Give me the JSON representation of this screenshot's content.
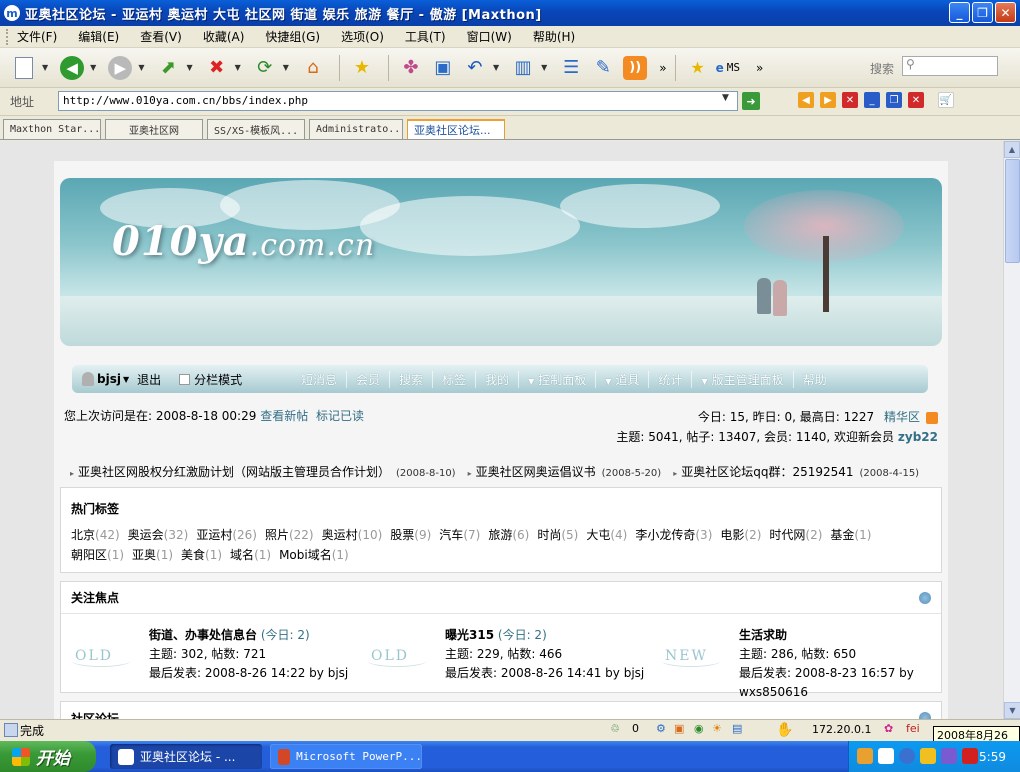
{
  "window": {
    "title": "亚奥社区论坛 - 亚运村 奥运村 大屯 社区网 街道 娱乐 旅游 餐厅 - 傲游 [Maxthon]"
  },
  "menu": [
    "文件(F)",
    "编辑(E)",
    "查看(V)",
    "收藏(A)",
    "快捷组(G)",
    "选项(O)",
    "工具(T)",
    "窗口(W)",
    "帮助(H)"
  ],
  "toolbar": {
    "ms_label": "MS",
    "search_label": "搜索"
  },
  "address": {
    "label": "地址",
    "url": "http://www.010ya.com.cn/bbs/index.php"
  },
  "tabs": [
    "Maxthon Star...",
    "亚奥社区网",
    "SS/XS-模板风...",
    "Administrato...",
    "亚奥社区论坛..."
  ],
  "banner": {
    "logo_main": "010ya",
    "logo_suffix": ".com.cn"
  },
  "nav": {
    "user": "bjsj",
    "logout": "退出",
    "mode": "分栏模式",
    "links": [
      "短消息",
      "会员",
      "搜索",
      "标签",
      "我的",
      "控制面板",
      "道具",
      "统计",
      "版主管理面板",
      "帮助"
    ]
  },
  "info": {
    "last_visit": "您上次访问是在: 2008-8-18 00:29",
    "new_posts": "查看新帖",
    "mark_read": "标记已读",
    "stats1": "今日: 15, 昨日: 0, 最高日: 1227",
    "digest": "精华区",
    "stats2": "主题: 5041, 帖子: 13407, 会员: 1140, 欢迎新会员",
    "new_member": "zyb22"
  },
  "announcements": [
    {
      "text": "亚奥社区网股权分红激励计划（网站版主管理员合作计划）",
      "date": "(2008-8-10)"
    },
    {
      "text": "亚奥社区网奥运倡议书",
      "date": "(2008-5-20)"
    },
    {
      "text": "亚奥社区论坛qq群：25192541",
      "date": "(2008-4-15)"
    }
  ],
  "hot_tags": {
    "title": "热门标签",
    "tags": [
      {
        "name": "北京",
        "count": "(42)"
      },
      {
        "name": "奥运会",
        "count": "(32)"
      },
      {
        "name": "亚运村",
        "count": "(26)"
      },
      {
        "name": "照片",
        "count": "(22)"
      },
      {
        "name": "奥运村",
        "count": "(10)"
      },
      {
        "name": "股票",
        "count": "(9)"
      },
      {
        "name": "汽车",
        "count": "(7)"
      },
      {
        "name": "旅游",
        "count": "(6)"
      },
      {
        "name": "时尚",
        "count": "(5)"
      },
      {
        "name": "大屯",
        "count": "(4)"
      },
      {
        "name": "李小龙传奇",
        "count": "(3)"
      },
      {
        "name": "电影",
        "count": "(2)"
      },
      {
        "name": "时代网",
        "count": "(2)"
      },
      {
        "name": "基金",
        "count": "(1)"
      },
      {
        "name": "朝阳区",
        "count": "(1)"
      },
      {
        "name": "亚奥",
        "count": "(1)"
      },
      {
        "name": "美食",
        "count": "(1)"
      },
      {
        "name": "域名",
        "count": "(1)"
      },
      {
        "name": "Mobi域名",
        "count": "(1)"
      }
    ]
  },
  "focus": {
    "title": "关注焦点",
    "items": [
      {
        "badge": "OLD",
        "name": "街道、办事处信息台",
        "today": "(今日: 2)",
        "stats": "主题: 302, 帖数: 721",
        "last": "最后发表: 2008-8-26 14:22 by bjsj",
        "last2": ""
      },
      {
        "badge": "OLD",
        "name": "曝光315",
        "today": "(今日: 2)",
        "stats": "主题: 229, 帖数: 466",
        "last": "最后发表: 2008-8-26 14:41 by bjsj",
        "last2": ""
      },
      {
        "badge": "NEW",
        "name": "生活求助",
        "today": "",
        "stats": "主题: 286, 帖数: 650",
        "last": "最后发表: 2008-8-23 16:57 by",
        "last2": "wxs850616"
      }
    ]
  },
  "next_section": "社区论坛",
  "status": {
    "text": "完成",
    "count": "0",
    "ip": "172.20.0.1",
    "tooltip": "2008年8月26日"
  },
  "taskbar": {
    "start": "开始",
    "tasks": [
      "亚奥社区论坛 - ...",
      "Microsoft PowerP..."
    ],
    "clock": "15:59"
  },
  "colors": {
    "title_blue": "#0a5fd8",
    "link_teal": "#336f86",
    "nav_teal": "#a6cad0",
    "taskbar_blue": "#245edb"
  }
}
